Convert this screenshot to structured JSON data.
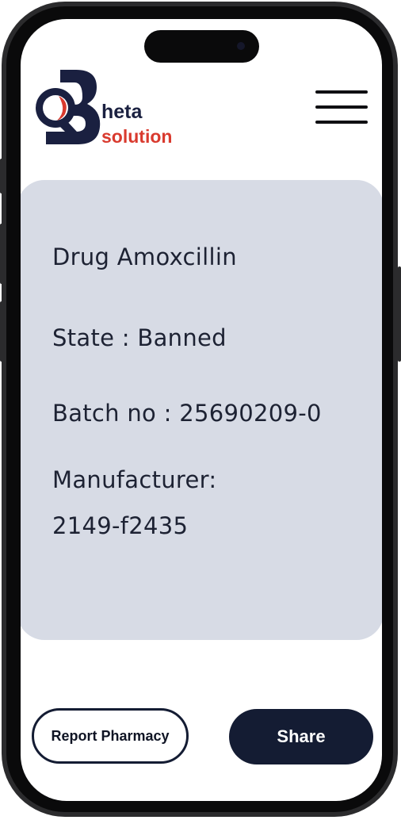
{
  "brand": {
    "line1": "heta",
    "line2": "solution",
    "primary_color": "#1a2040",
    "accent_color": "#d93a2e"
  },
  "header": {
    "menu_icon": "hamburger-menu-icon"
  },
  "drug_info": {
    "drug": "Drug Amoxcillin",
    "state": "State : Banned",
    "batch": "Batch no : 25690209-0",
    "manufacturer_label": "Manufacturer:",
    "manufacturer_value": "2149-f2435"
  },
  "actions": {
    "report_label": "Report Pharmacy",
    "share_label": "Share"
  },
  "colors": {
    "card_background": "#d7dbe5",
    "button_dark": "#141c33"
  }
}
